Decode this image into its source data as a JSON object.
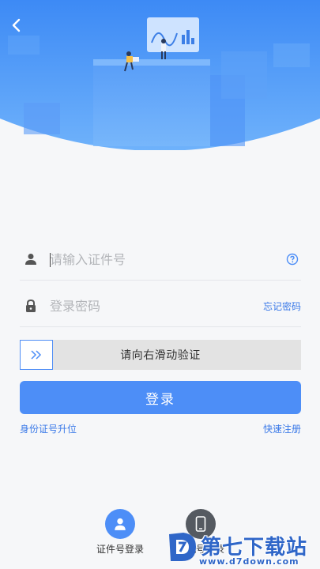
{
  "colors": {
    "hero_top": "#3d8af5",
    "hero_bottom": "#6fb2fb",
    "accent": "#4d8ef7",
    "link": "#3a79e8",
    "background": "#f6f7f9"
  },
  "header": {
    "back_icon": "chevron-left-icon"
  },
  "login_form": {
    "id_field": {
      "placeholder": "请输入证件号",
      "icon": "user-icon",
      "help_icon": "question-circle-icon"
    },
    "password_field": {
      "placeholder": "登录密码",
      "icon": "lock-icon",
      "forgot_label": "忘记密码"
    },
    "slider": {
      "text": "请向右滑动验证",
      "handle_icon": "double-chevron-right-icon"
    },
    "login_button": "登录",
    "upgrade_link": "身份证号升位",
    "register_link": "快速注册"
  },
  "bottom_options": [
    {
      "label": "证件号登录",
      "icon": "user-circle-icon"
    },
    {
      "label": "手机号登录",
      "icon": "phone-icon"
    }
  ],
  "watermark": {
    "title": "第七下载站",
    "url": "www.d7down.com",
    "logo_letter": "D"
  }
}
